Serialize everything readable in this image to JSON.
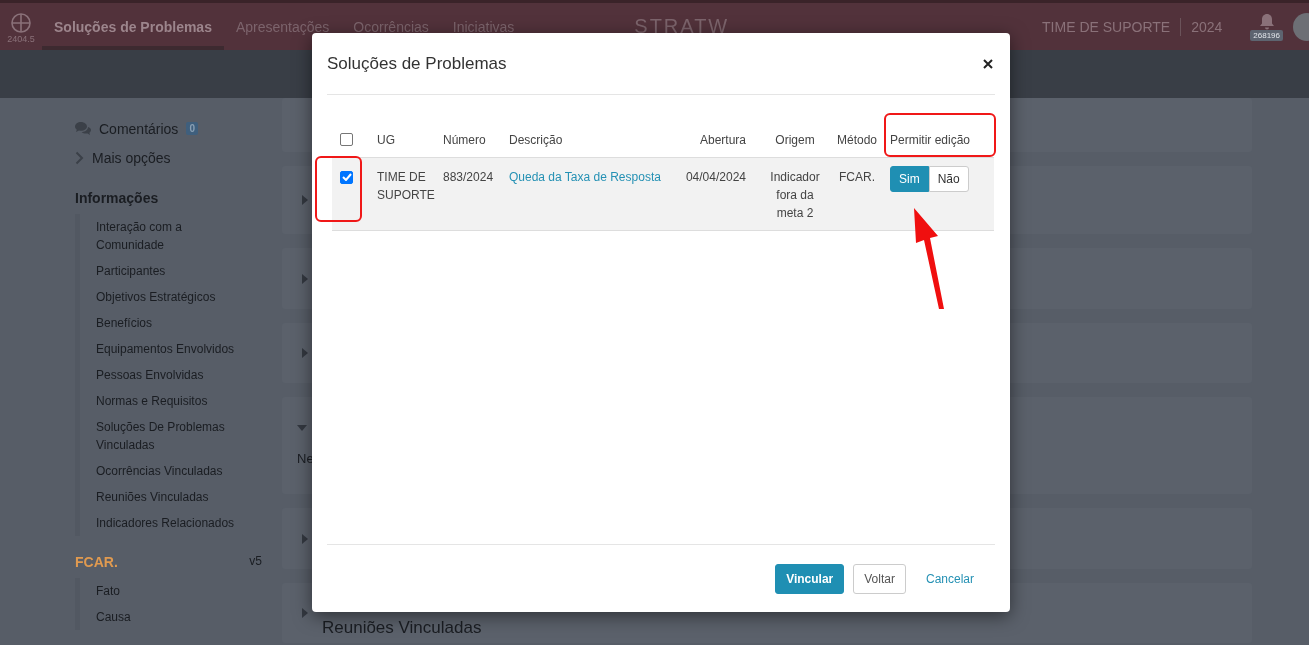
{
  "top_bar": {
    "version": "2404.5",
    "nav": [
      {
        "label": "Soluções de Problemas",
        "selected": true
      },
      {
        "label": "Apresentações",
        "selected": false
      },
      {
        "label": "Ocorrências",
        "selected": false
      },
      {
        "label": "Iniciativas",
        "selected": false
      }
    ],
    "logo": "STRATW",
    "team": "TIME DE SUPORTE",
    "year": "2024",
    "notifications": "268196"
  },
  "sidebar": {
    "comments": {
      "label": "Comentários",
      "count": "0"
    },
    "more": "Mais opções",
    "sections": [
      {
        "title": "Informações",
        "kind": "info",
        "items": [
          "Interação com a Comunidade",
          "Participantes",
          "Objetivos Estratégicos",
          "Benefícios",
          "Equipamentos Envolvidos",
          "Pessoas Envolvidas",
          "Normas e Requisitos",
          "Soluções De Problemas Vinculadas",
          "Ocorrências Vinculadas",
          "Reuniões Vinculadas",
          "Indicadores Relacionados"
        ]
      },
      {
        "title": "FCAR.",
        "kind": "method",
        "version": "v5",
        "items": [
          "Fato",
          "Causa"
        ]
      }
    ]
  },
  "background": {
    "partial_text": "Ne",
    "last_section": "Reuniões Vinculadas"
  },
  "modal": {
    "title": "Soluções de Problemas",
    "select_all_checked": false,
    "columns": [
      "UG",
      "Número",
      "Descrição",
      "Abertura",
      "Origem",
      "Método",
      "Permitir edição"
    ],
    "rows": [
      {
        "checked": true,
        "ug": "TIME DE SUPORTE",
        "number": "883/2024",
        "description": "Queda da Taxa de Resposta",
        "opened": "04/04/2024",
        "origin": "Indicador fora da meta 2",
        "method": "FCAR.",
        "edit_options": [
          {
            "label": "Sim",
            "selected": true
          },
          {
            "label": "Não",
            "selected": false
          }
        ]
      }
    ],
    "buttons": [
      {
        "label": "Vincular",
        "kind": "primary"
      },
      {
        "label": "Voltar",
        "kind": "default"
      },
      {
        "label": "Cancelar",
        "kind": "link"
      }
    ]
  }
}
